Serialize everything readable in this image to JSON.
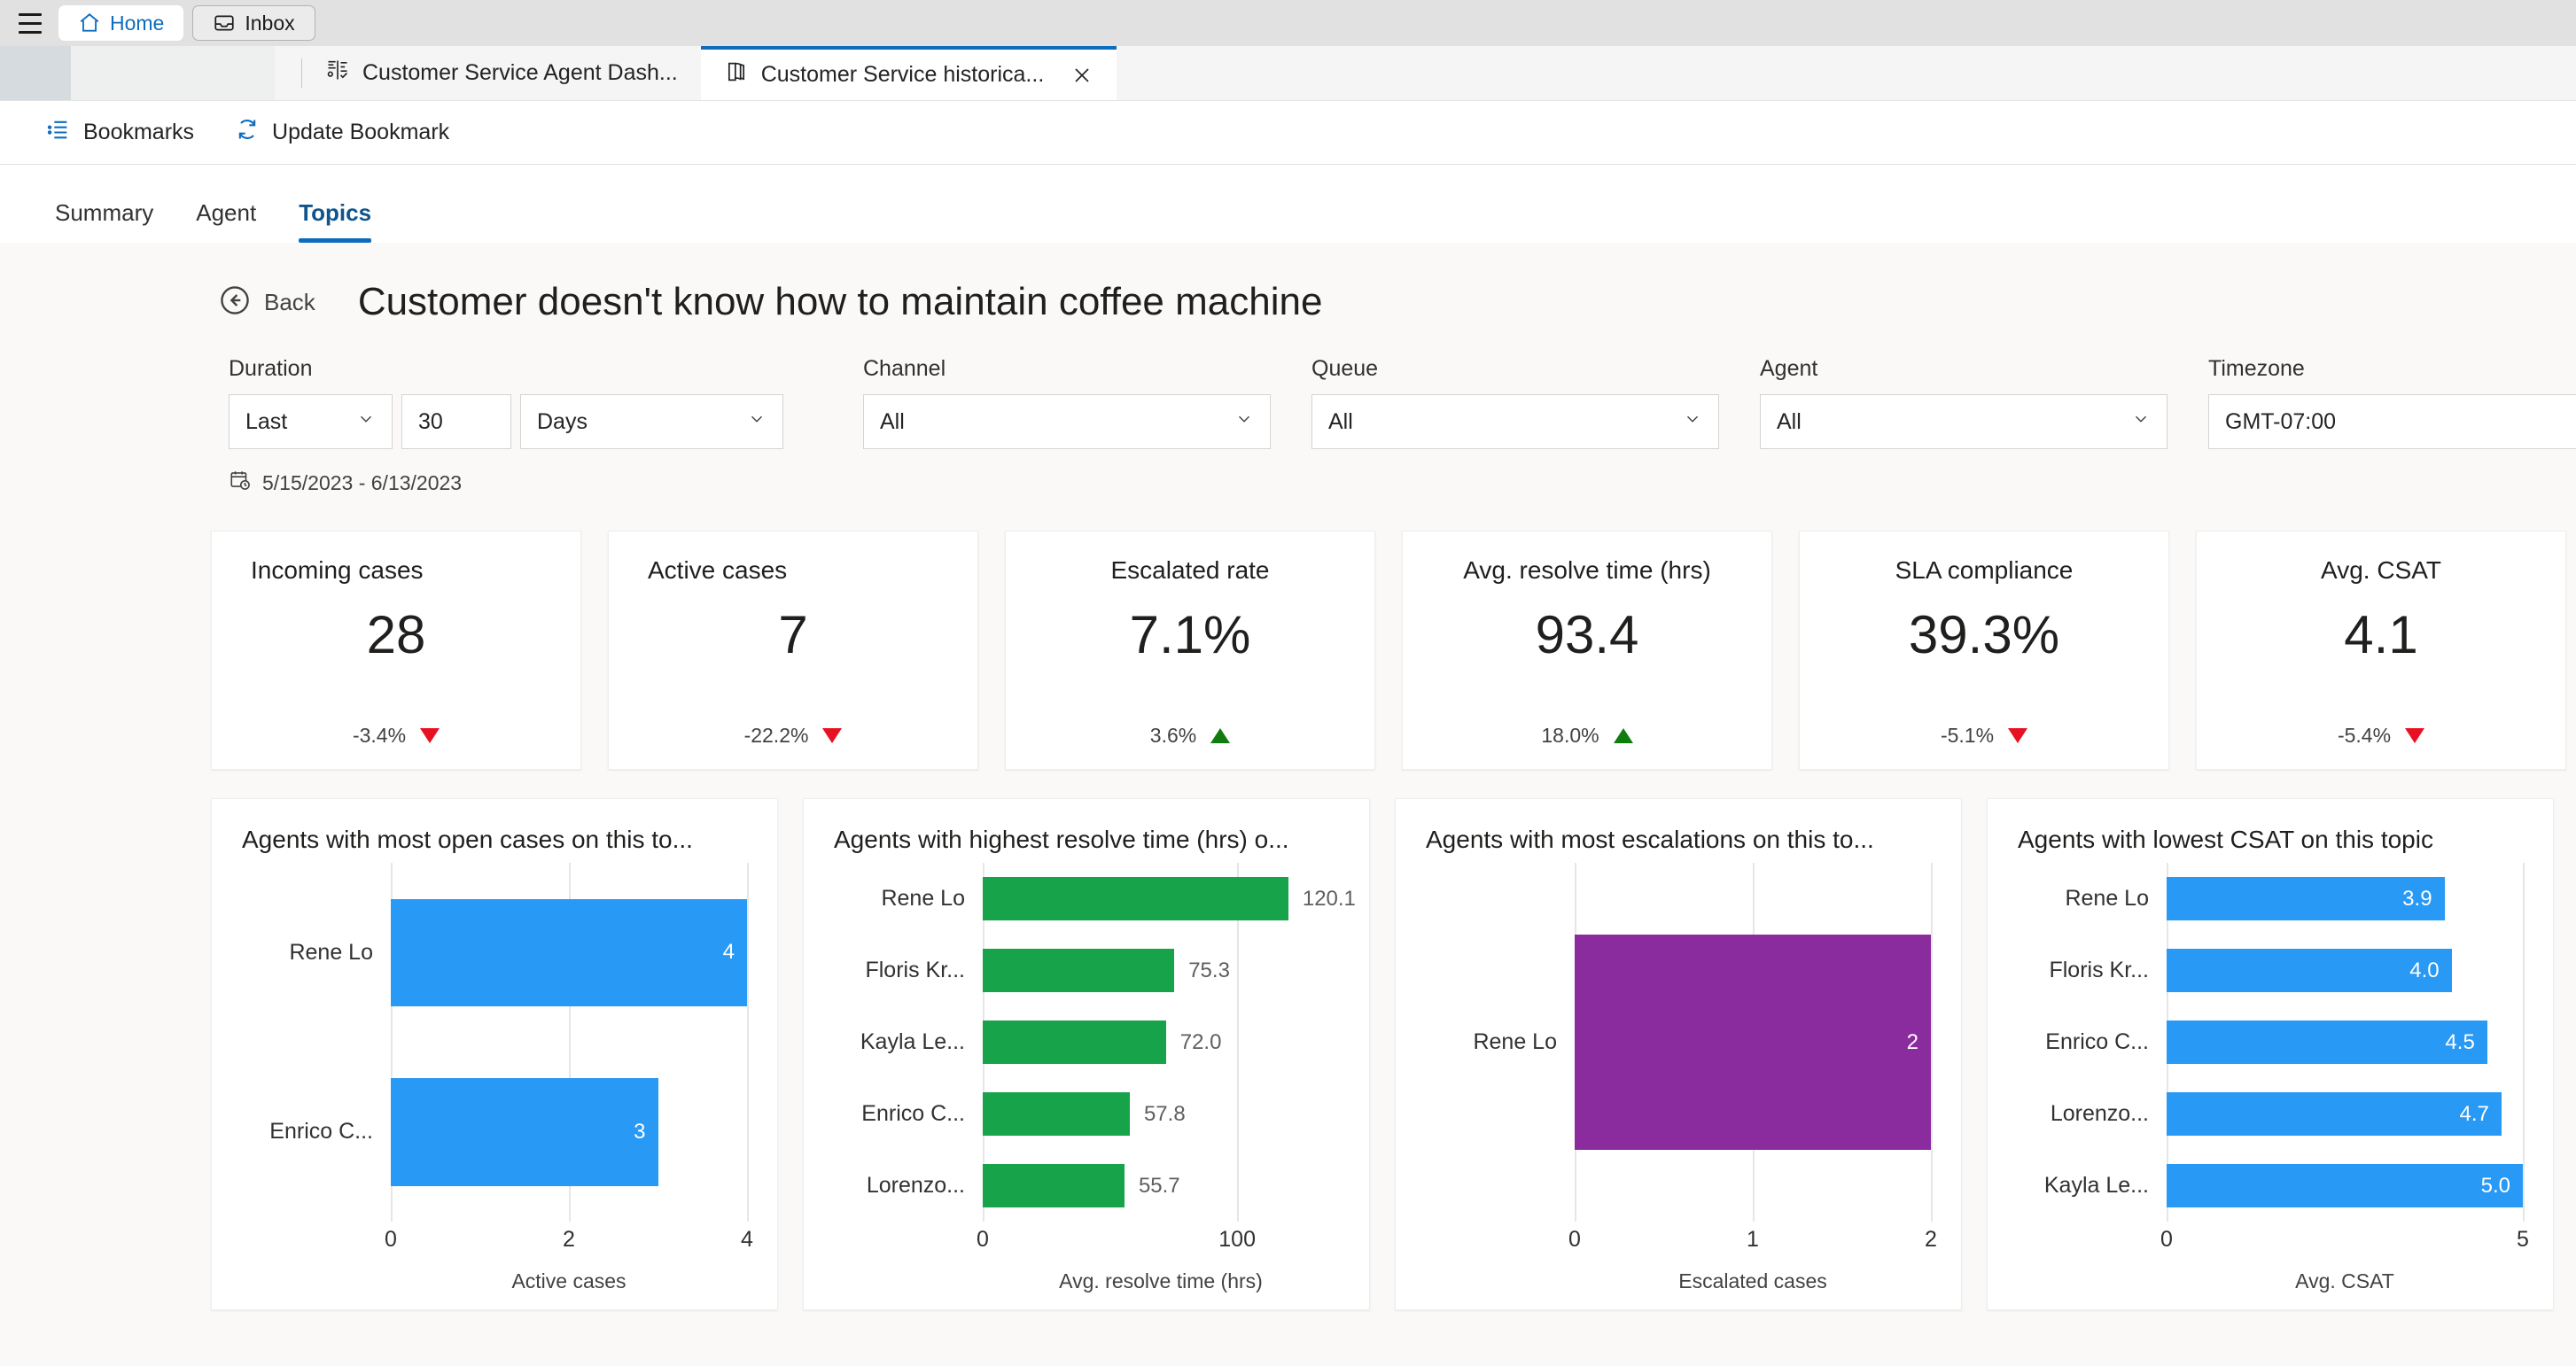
{
  "chrome": {
    "menu_icon": "hamburger-icon",
    "tabs": [
      {
        "label": "Home",
        "icon": "home-icon",
        "active": true
      },
      {
        "label": "Inbox",
        "icon": "inbox-icon",
        "active": false
      }
    ]
  },
  "app_tabs": [
    {
      "label": "Customer Service Agent Dash...",
      "icon": "dashboard-icon",
      "selected": false
    },
    {
      "label": "Customer Service historica...",
      "icon": "book-icon",
      "selected": true,
      "close_icon": "close-icon"
    }
  ],
  "bookmarks_bar": {
    "bookmarks_label": "Bookmarks",
    "bookmarks_icon": "bookmarks-icon",
    "update_label": "Update Bookmark",
    "update_icon": "refresh-icon"
  },
  "page_tabs": [
    {
      "label": "Summary",
      "active": false
    },
    {
      "label": "Agent",
      "active": false
    },
    {
      "label": "Topics",
      "active": true
    }
  ],
  "header": {
    "back_label": "Back",
    "back_icon": "arrow-left-circle-icon",
    "title": "Customer doesn't know how to maintain coffee machine"
  },
  "filters": {
    "duration": {
      "label": "Duration",
      "mode": "Last",
      "amount": "30",
      "unit": "Days"
    },
    "channel": {
      "label": "Channel",
      "value": "All"
    },
    "queue": {
      "label": "Queue",
      "value": "All"
    },
    "agent": {
      "label": "Agent",
      "value": "All"
    },
    "timezone": {
      "label": "Timezone",
      "value": "GMT-07:00"
    },
    "date_range": "5/15/2023 - 6/13/2023",
    "date_range_icon": "calendar-clock-icon",
    "chevron_icon": "chevron-down-icon"
  },
  "kpis": [
    {
      "title": "Incoming cases",
      "value": "28",
      "delta": "-3.4%",
      "direction": "down",
      "align": "left"
    },
    {
      "title": "Active cases",
      "value": "7",
      "delta": "-22.2%",
      "direction": "down",
      "align": "left"
    },
    {
      "title": "Escalated rate",
      "value": "7.1%",
      "delta": "3.6%",
      "direction": "up",
      "align": "center"
    },
    {
      "title": "Avg. resolve time (hrs)",
      "value": "93.4",
      "delta": "18.0%",
      "direction": "up",
      "align": "center"
    },
    {
      "title": "SLA compliance",
      "value": "39.3%",
      "delta": "-5.1%",
      "direction": "down",
      "align": "center"
    },
    {
      "title": "Avg. CSAT",
      "value": "4.1",
      "delta": "-5.4%",
      "direction": "down",
      "align": "center"
    }
  ],
  "colors": {
    "blue": "#2899f5",
    "green": "#16a34a",
    "purple": "#8a2b9e",
    "accent": "#0f6cbd",
    "up": "#107c10",
    "down": "#e81123"
  },
  "chart_data": [
    {
      "type": "bar",
      "orientation": "horizontal",
      "title": "Agents with most open cases on this to...",
      "categories": [
        "Rene Lo",
        "Enrico C..."
      ],
      "values": [
        4,
        3
      ],
      "labels": [
        "4",
        "3"
      ],
      "xlabel": "Active cases",
      "ylabel": "",
      "xlim": [
        0,
        4
      ],
      "xticks": [
        "0",
        "2",
        "4"
      ],
      "xtick_values": [
        0,
        2,
        4
      ],
      "grid": true,
      "color": "#2899f5",
      "label_position": "inside"
    },
    {
      "type": "bar",
      "orientation": "horizontal",
      "title": "Agents with highest resolve time (hrs) o...",
      "categories": [
        "Rene Lo",
        "Floris Kr...",
        "Kayla Le...",
        "Enrico C...",
        "Lorenzo..."
      ],
      "values": [
        120.1,
        75.3,
        72.0,
        57.8,
        55.7
      ],
      "labels": [
        "120.1",
        "75.3",
        "72.0",
        "57.8",
        "55.7"
      ],
      "xlabel": "Avg. resolve time (hrs)",
      "ylabel": "",
      "xlim": [
        0,
        140
      ],
      "xticks": [
        "0",
        "100"
      ],
      "xtick_values": [
        0,
        100
      ],
      "grid": true,
      "color": "#16a34a",
      "label_position": "outside"
    },
    {
      "type": "bar",
      "orientation": "horizontal",
      "title": "Agents with most escalations on this to...",
      "categories": [
        "Rene Lo"
      ],
      "values": [
        2
      ],
      "labels": [
        "2"
      ],
      "xlabel": "Escalated cases",
      "ylabel": "",
      "xlim": [
        0,
        2
      ],
      "xticks": [
        "0",
        "1",
        "2"
      ],
      "xtick_values": [
        0,
        1,
        2
      ],
      "grid": true,
      "color": "#8a2b9e",
      "label_position": "inside"
    },
    {
      "type": "bar",
      "orientation": "horizontal",
      "title": "Agents with lowest CSAT on this topic",
      "categories": [
        "Rene Lo",
        "Floris Kr...",
        "Enrico C...",
        "Lorenzo...",
        "Kayla Le..."
      ],
      "values": [
        3.9,
        4.0,
        4.5,
        4.7,
        5.0
      ],
      "labels": [
        "3.9",
        "4.0",
        "4.5",
        "4.7",
        "5.0"
      ],
      "xlabel": "Avg. CSAT",
      "ylabel": "",
      "xlim": [
        0,
        5
      ],
      "xticks": [
        "0",
        "5"
      ],
      "xtick_values": [
        0,
        5
      ],
      "grid": true,
      "color": "#2899f5",
      "label_position": "inside"
    }
  ]
}
